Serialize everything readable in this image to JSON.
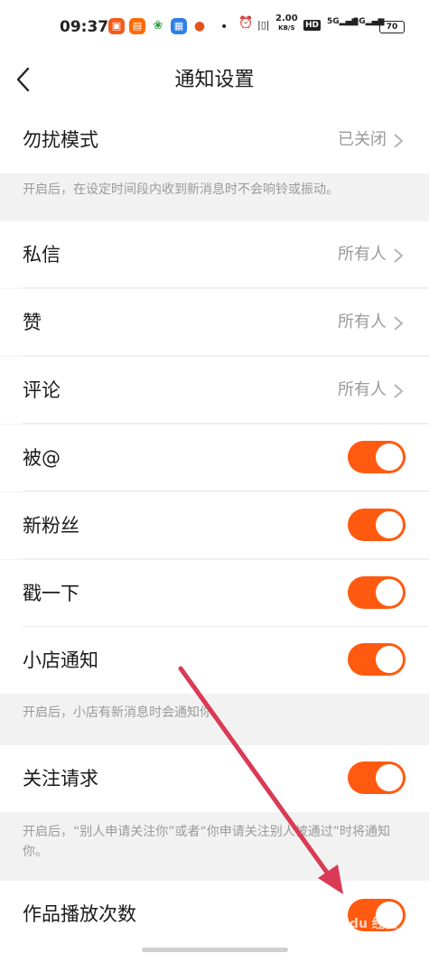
{
  "status_bar": {
    "time": "09:37",
    "net_speed_value": "2.00",
    "net_speed_unit": "KB/S",
    "hd": "HD",
    "signal_1": "5G",
    "signal_2": "5G",
    "battery": "70"
  },
  "header": {
    "title": "通知设置"
  },
  "dnd": {
    "label": "勿扰模式",
    "value": "已关闭",
    "hint": "开启后，在设定时间段内收到新消息时不会响铃或振动。"
  },
  "messages": [
    {
      "label": "私信",
      "value": "所有人"
    },
    {
      "label": "赞",
      "value": "所有人"
    },
    {
      "label": "评论",
      "value": "所有人"
    }
  ],
  "toggles": [
    {
      "label": "被@",
      "on": true
    },
    {
      "label": "新粉丝",
      "on": true
    },
    {
      "label": "戳一下",
      "on": true
    },
    {
      "label": "小店通知",
      "on": true
    }
  ],
  "shop_hint": "开启后，小店有新消息时会通知你",
  "follow_request": {
    "label": "关注请求",
    "on": true,
    "hint": "开启后，“别人申请关注你”或者“你申请关注别人被通过”时将通知你。"
  },
  "play_count": {
    "label": "作品播放次数",
    "on": true
  },
  "watermark": "Baidu 经验",
  "colors": {
    "accent": "#ff5a0f",
    "annotation_arrow": "#d93a55"
  }
}
